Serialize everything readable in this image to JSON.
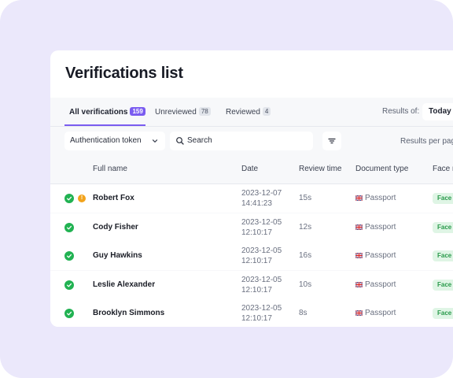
{
  "page": {
    "title": "Verifications list"
  },
  "tabs": [
    {
      "label": "All verifications",
      "count": "159"
    },
    {
      "label": "Unreviewed",
      "count": "78"
    },
    {
      "label": "Reviewed",
      "count": "4"
    }
  ],
  "results": {
    "label": "Results of:",
    "value": "Today"
  },
  "filters": {
    "auth_select": "Authentication token",
    "search_placeholder": "Search",
    "results_per_page": "Results per pag"
  },
  "table": {
    "headers": {
      "full_name": "Full name",
      "date": "Date",
      "review_time": "Review time",
      "document_type": "Document type",
      "face": "Face m"
    },
    "rows": [
      {
        "name": "Robert Fox",
        "date": "2023-12-07",
        "time": "14:41:23",
        "review": "15s",
        "doc": "Passport",
        "face": "Face m",
        "warning": "!"
      },
      {
        "name": "Cody Fisher",
        "date": "2023-12-05",
        "time": "12:10:17",
        "review": "12s",
        "doc": "Passport",
        "face": "Face m"
      },
      {
        "name": "Guy Hawkins",
        "date": "2023-12-05",
        "time": "12:10:17",
        "review": "16s",
        "doc": "Passport",
        "face": "Face m"
      },
      {
        "name": "Leslie Alexander",
        "date": "2023-12-05",
        "time": "12:10:17",
        "review": "10s",
        "doc": "Passport",
        "face": "Face m"
      },
      {
        "name": "Brooklyn Simmons",
        "date": "2023-12-05",
        "time": "12:10:17",
        "review": "8s",
        "doc": "Passport",
        "face": "Face m"
      }
    ]
  },
  "colors": {
    "accent": "#7a5cf0",
    "success": "#21b252",
    "warning": "#f2a31c",
    "background": "#ebe8fb"
  },
  "icons": {
    "status": "check-circle-icon",
    "warning": "warning-icon",
    "flag": "uk-flag-icon",
    "search": "search-icon",
    "filter": "filter-icon",
    "chevron": "chevron-down-icon"
  }
}
